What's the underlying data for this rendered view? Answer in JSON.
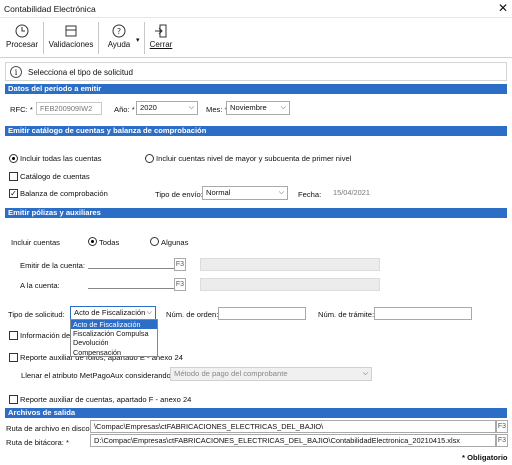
{
  "window": {
    "title": "Contabilidad Electrónica",
    "close_glyph": "✕"
  },
  "toolbar": {
    "procesar": "Procesar",
    "validaciones": "Validaciones",
    "ayuda": "Ayuda",
    "cerrar": "Cerrar"
  },
  "info": {
    "icon": "i",
    "text": "Selecciona el tipo de solicitud"
  },
  "periodo": {
    "section_title": "Datos del periodo a emitir",
    "rfc_label": "RFC: *",
    "rfc_value": "FEB200909IW2",
    "anio_label": "Año: *",
    "anio_value": "2020",
    "mes_label": "Mes: *",
    "mes_value": "Noviembre"
  },
  "catalogo": {
    "section_title": "Emitir catálogo de cuentas y balanza de comprobación",
    "radio_todas": "Incluir todas las cuentas",
    "radio_mayor": "Incluir cuentas nivel de mayor y subcuenta de primer nivel",
    "chk_catalogo": "Catálogo de cuentas",
    "chk_balanza": "Balanza de comprobación",
    "tipo_envio_label": "Tipo de envío:",
    "tipo_envio_value": "Normal",
    "fecha_label": "Fecha:",
    "fecha_value": "15/04/2021"
  },
  "polizas": {
    "section_title": "Emitir pólizas y auxiliares",
    "incluir_label": "Incluir cuentas",
    "radio_todas": "Todas",
    "radio_algunas": "Algunas",
    "emitir_label": "Emitir de la cuenta:",
    "a_label": "A la cuenta:",
    "f3": "F3",
    "tipo_solicitud_label": "Tipo de solicitud:",
    "tipo_solicitud_value": "Acto de Fiscalización",
    "tipo_options": [
      "Acto de Fiscalización",
      "Fiscalización Compulsa",
      "Devolución",
      "Compensación"
    ],
    "num_orden_label": "Núm. de orden:",
    "num_tramite_label": "Núm. de trámite:",
    "chk_info": "Información de p",
    "chk_reporte_folios": "Reporte auxiliar de folios, apartado E - anexo 24",
    "llenar_label": "Llenar el atributo MetPagoAux considerando:",
    "metodo_value": "Método de pago del comprobante",
    "chk_reporte_cuentas": "Reporte auxiliar de cuentas, apartado F - anexo 24"
  },
  "archivos": {
    "section_title": "Archivos de salida",
    "ruta_disco_label": "Ruta de archivo en disco: *",
    "ruta_disco_value": "\\Compac\\Empresas\\ctFABRICACIONES_ELECTRICAS_DEL_BAJIO\\",
    "ruta_bitacora_label": "Ruta de bitácora: *",
    "ruta_bitacora_value": "D:\\Compac\\Empresas\\ctFABRICACIONES_ELECTRICAS_DEL_BAJIO\\ContabilidadElectronica_20210415.xlsx",
    "f3": "F3",
    "obligatorio": "* Obligatorio"
  }
}
